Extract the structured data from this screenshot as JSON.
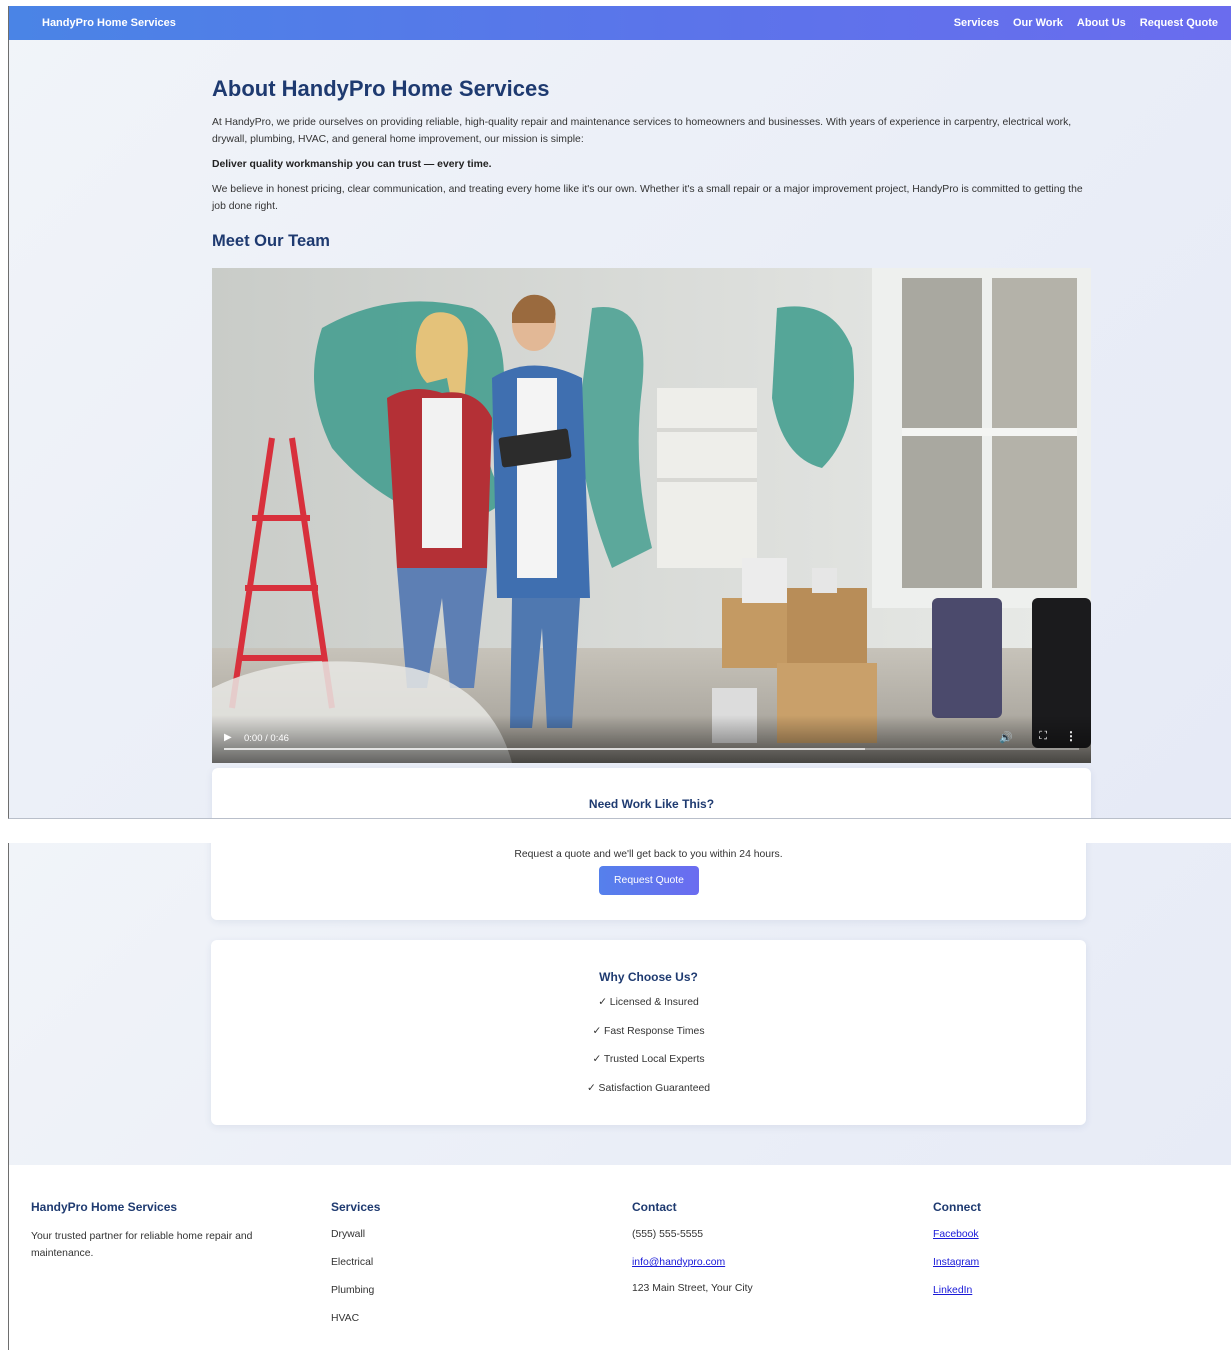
{
  "nav": {
    "brand": "HandyPro Home Services",
    "links": [
      "Services",
      "Our Work",
      "About Us",
      "Request Quote"
    ]
  },
  "about": {
    "title": "About HandyPro Home Services",
    "intro": "At HandyPro, we pride ourselves on providing reliable, high-quality repair and maintenance services to homeowners and businesses. With years of experience in carpentry, electrical work, drywall, plumbing, HVAC, and general home improvement, our mission is simple:",
    "mission": "Deliver quality workmanship you can trust — every time.",
    "belief": "We believe in honest pricing, clear communication, and treating every home like it's our own. Whether it's a small repair or a major improvement project, HandyPro is committed to getting the job done right."
  },
  "team": {
    "title": "Meet Our Team",
    "video": {
      "time": "0:00 / 0:46",
      "buffered_fraction": 0.75,
      "icons": [
        "play-icon",
        "volume-icon",
        "fullscreen-icon",
        "more-options-icon"
      ]
    }
  },
  "cta": {
    "title": "Need Work Like This?",
    "text": "Request a quote and we'll get back to you within 24 hours.",
    "button": "Request Quote"
  },
  "why": {
    "title": "Why Choose Us?",
    "items": [
      "✓ Licensed & Insured",
      "✓ Fast Response Times",
      "✓ Trusted Local Experts",
      "✓ Satisfaction Guaranteed"
    ]
  },
  "footer": {
    "brand": {
      "title": "HandyPro Home Services",
      "description": "Your trusted partner for reliable home repair and maintenance."
    },
    "services": {
      "title": "Services",
      "items": [
        "Drywall",
        "Electrical",
        "Plumbing",
        "HVAC"
      ]
    },
    "contact": {
      "title": "Contact",
      "phone": "(555) 555-5555",
      "email": "info@handypro.com",
      "address": "123 Main Street, Your City"
    },
    "connect": {
      "title": "Connect",
      "links": [
        "Facebook",
        "Instagram",
        "LinkedIn"
      ]
    }
  },
  "colors": {
    "nav_gradient_start": "#4a84e6",
    "nav_gradient_end": "#6a6cee",
    "heading": "#1e3a70",
    "link": "#1a1ad8",
    "button_start": "#5580ec",
    "button_end": "#6b6cf0"
  }
}
